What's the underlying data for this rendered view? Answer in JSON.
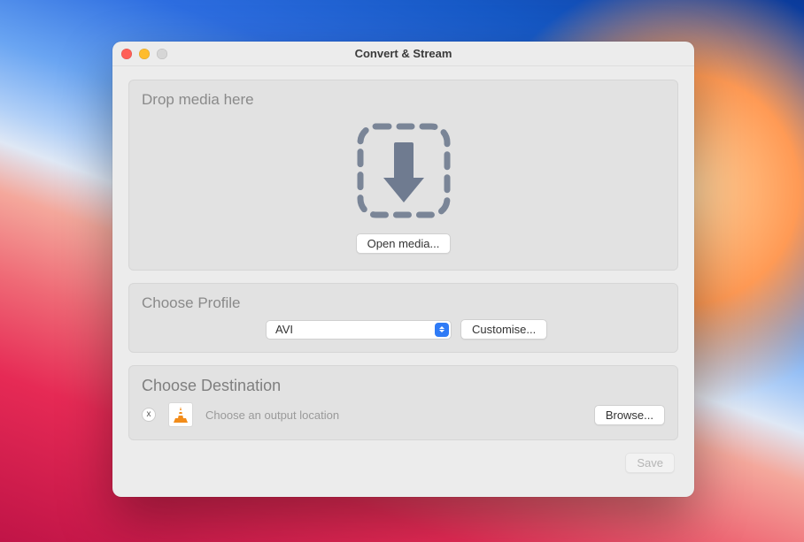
{
  "window": {
    "title": "Convert & Stream"
  },
  "drop": {
    "title": "Drop media here",
    "open_label": "Open media..."
  },
  "profile": {
    "title": "Choose Profile",
    "selected": "AVI",
    "customise_label": "Customise..."
  },
  "destination": {
    "title": "Choose Destination",
    "close_label": "x",
    "hint": "Choose an output location",
    "browse_label": "Browse..."
  },
  "footer": {
    "save_label": "Save"
  }
}
